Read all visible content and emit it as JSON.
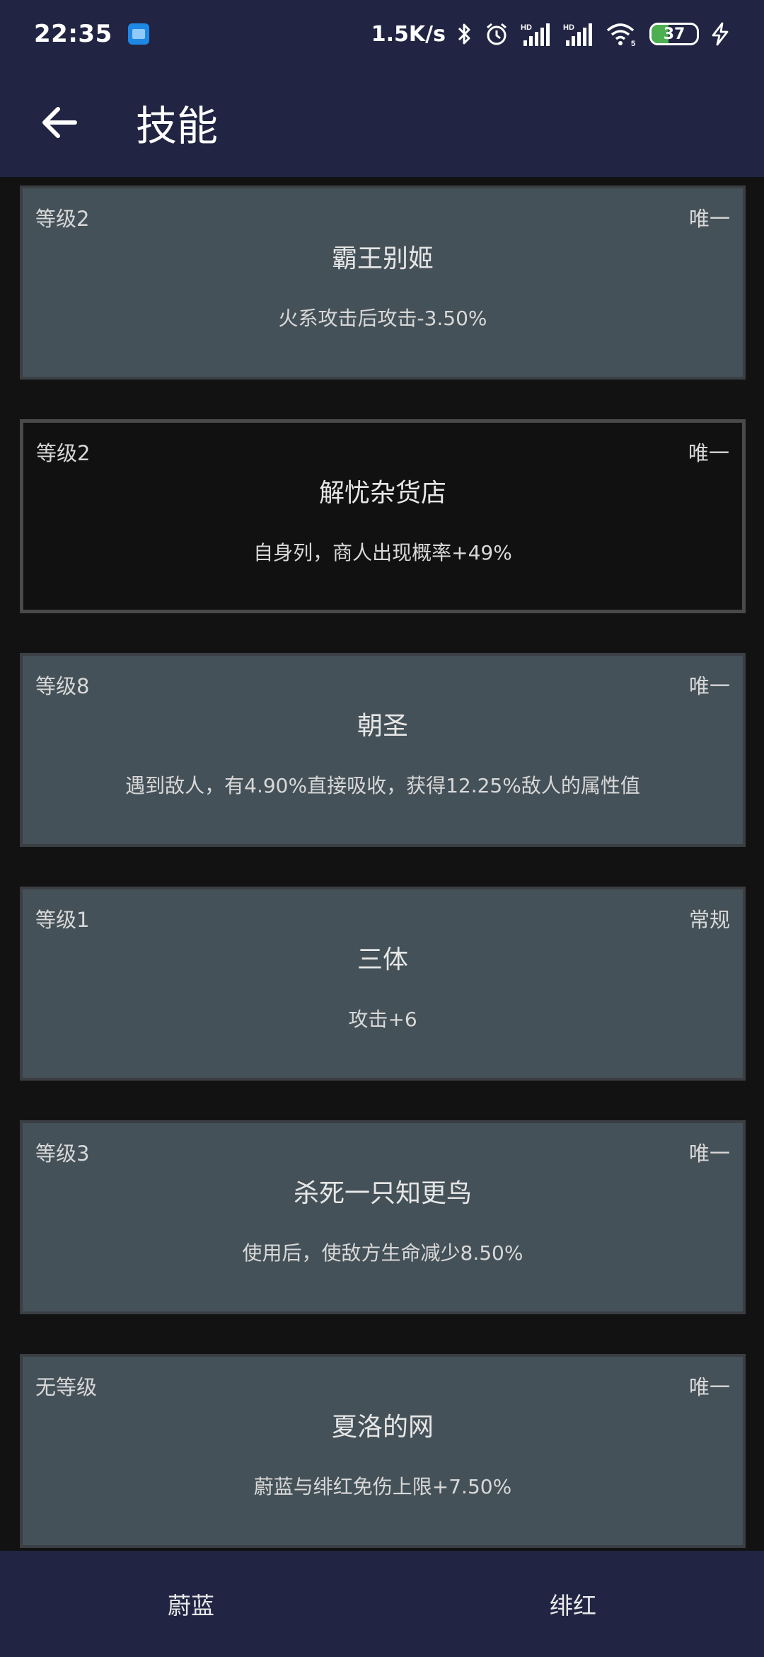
{
  "status_bar": {
    "time": "22:35",
    "net_speed": "1.5K/s",
    "battery_level": "37",
    "battery_fraction": 0.37,
    "icons": [
      "app-icon",
      "bluetooth-icon",
      "alarm-icon",
      "signal-hd-icon",
      "signal-hd-icon",
      "wifi-icon",
      "battery-icon",
      "charging-icon"
    ]
  },
  "appbar": {
    "back_icon": "arrow-left-icon",
    "title": "技能"
  },
  "skills": [
    {
      "level": "等级2",
      "type": "唯一",
      "name": "霸王别姬",
      "desc": "火系攻击后攻击-3.50%",
      "selected": false
    },
    {
      "level": "等级2",
      "type": "唯一",
      "name": "解忧杂货店",
      "desc": "自身列，商人出现概率+49%",
      "selected": true
    },
    {
      "level": "等级8",
      "type": "唯一",
      "name": "朝圣",
      "desc": "遇到敌人，有4.90%直接吸收，获得12.25%敌人的属性值",
      "selected": false
    },
    {
      "level": "等级1",
      "type": "常规",
      "name": "三体",
      "desc": "攻击+6",
      "selected": false
    },
    {
      "level": "等级3",
      "type": "唯一",
      "name": "杀死一只知更鸟",
      "desc": "使用后，使敌方生命减少8.50%",
      "selected": false
    },
    {
      "level": "无等级",
      "type": "唯一",
      "name": "夏洛的网",
      "desc": "蔚蓝与绯红免伤上限+7.50%",
      "selected": false
    }
  ],
  "bottom_tabs": [
    "蔚蓝",
    "绯红"
  ],
  "colors": {
    "bar_bg": "#212543",
    "card_bg": "#455158",
    "page_bg": "#121212",
    "battery_fill": "#4caf50"
  }
}
